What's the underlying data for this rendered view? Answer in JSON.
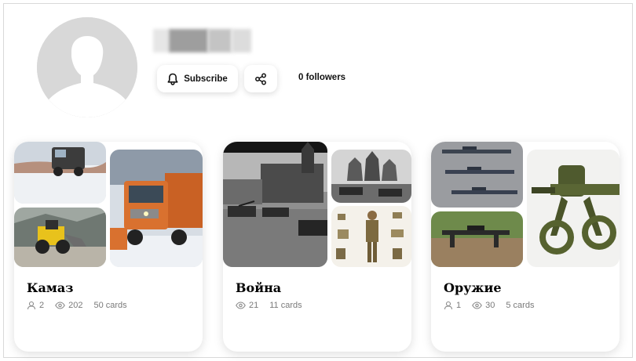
{
  "profile": {
    "subscribe_label": "Subscribe",
    "followers_label": "0 followers",
    "avatar_icon": "user-silhouette-icon",
    "bell_icon": "bell-icon",
    "share_icon": "share-icon"
  },
  "collections": [
    {
      "title": "Камаз",
      "subscribers": "2",
      "views": "202",
      "cards": "50 cards"
    },
    {
      "title": "Война",
      "views": "21",
      "cards": "11 cards"
    },
    {
      "title": "Оружие",
      "subscribers": "1",
      "views": "30",
      "cards": "5 cards"
    }
  ],
  "colors": {
    "avatar_bg": "#d8d8d8",
    "text_muted": "#7a7a7a",
    "accent_orange": "#d9712f"
  }
}
